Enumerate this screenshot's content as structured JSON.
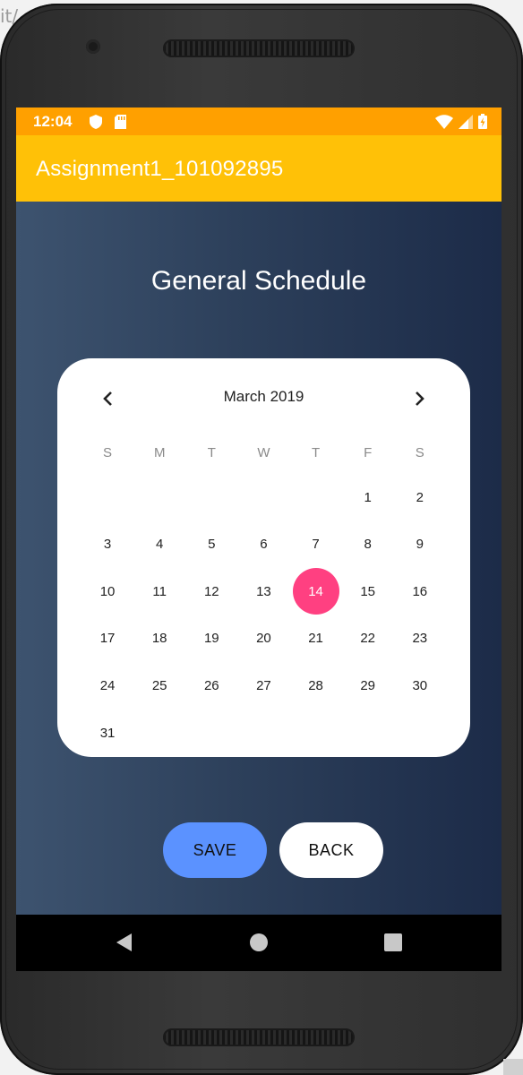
{
  "background": {
    "fragment_text": "it/"
  },
  "status_bar": {
    "time": "12:04",
    "left_icons": [
      "shield-icon",
      "sd-card-icon"
    ],
    "right_icons": [
      "wifi-icon",
      "signal-icon",
      "battery-charging-icon"
    ],
    "color": "#ffa000"
  },
  "app_bar": {
    "title": "Assignment1_101092895",
    "color": "#ffc107"
  },
  "page": {
    "heading": "General Schedule"
  },
  "calendar": {
    "month_label": "March 2019",
    "weekdays": [
      "S",
      "M",
      "T",
      "W",
      "T",
      "F",
      "S"
    ],
    "weeks": [
      [
        "",
        "",
        "",
        "",
        "",
        "1",
        "2"
      ],
      [
        "3",
        "4",
        "5",
        "6",
        "7",
        "8",
        "9"
      ],
      [
        "10",
        "11",
        "12",
        "13",
        "14",
        "15",
        "16"
      ],
      [
        "17",
        "18",
        "19",
        "20",
        "21",
        "22",
        "23"
      ],
      [
        "24",
        "25",
        "26",
        "27",
        "28",
        "29",
        "30"
      ],
      [
        "31",
        "",
        "",
        "",
        "",
        "",
        ""
      ]
    ],
    "selected_day": "14",
    "selected_color": "#ff4081"
  },
  "buttons": {
    "save": "SAVE",
    "back": "BACK",
    "save_color": "#5b92ff"
  },
  "nav_bar": {
    "icons": [
      "back-triangle-icon",
      "home-circle-icon",
      "recents-square-icon"
    ]
  }
}
